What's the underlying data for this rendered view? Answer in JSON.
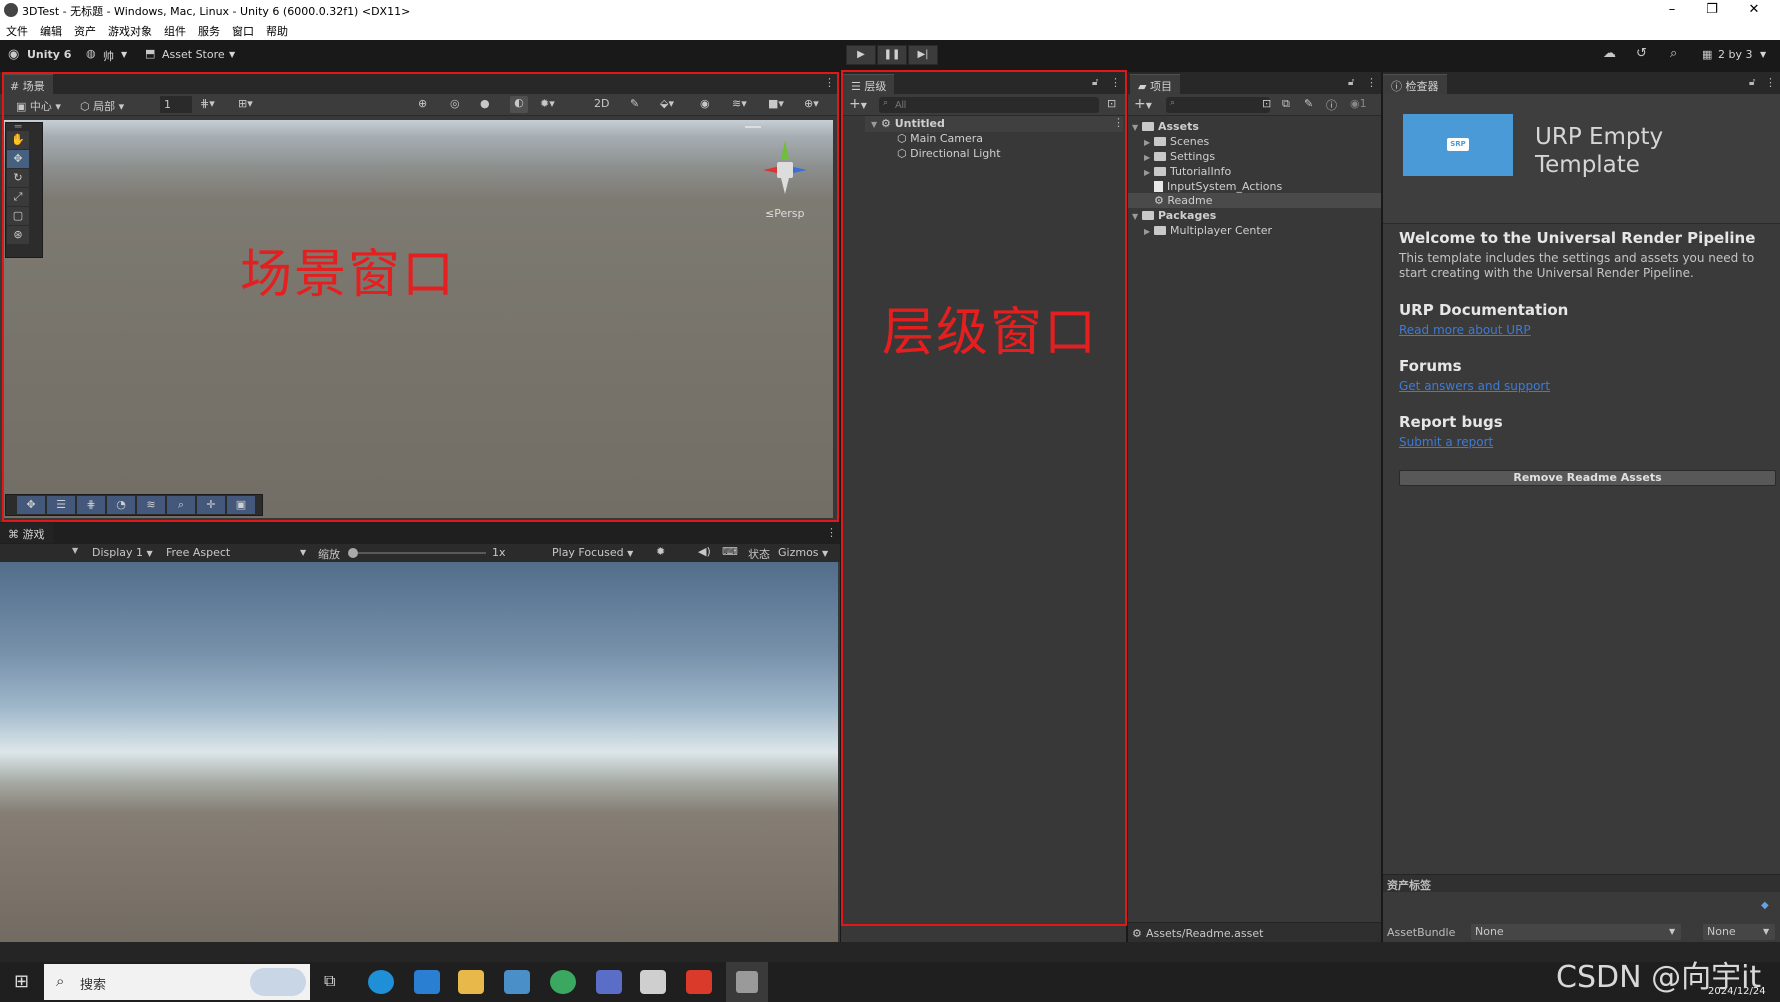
{
  "window": {
    "title": "3DTest - 无标题 - Windows, Mac, Linux - Unity 6 (6000.0.32f1) <DX11>",
    "minimize": "–",
    "maximize": "❐",
    "close": "✕"
  },
  "menu": [
    "文件",
    "编辑",
    "资产",
    "游戏对象",
    "组件",
    "服务",
    "窗口",
    "帮助"
  ],
  "toolbar": {
    "unity_label": "Unity 6",
    "account_label": "帅",
    "asset_store_label": "Asset Store",
    "play": "▶",
    "pause": "❚❚",
    "step": "▶|",
    "layout_label": "2 by 3"
  },
  "scene": {
    "tab_label": "场景",
    "pivot_label": "中心",
    "space_label": "局部",
    "snap_value": "1",
    "persp_label": "≤Persp",
    "overlay_text": "场景窗口"
  },
  "game": {
    "tab_label": "游戏",
    "display_label": "Display 1",
    "aspect_label": "Free Aspect",
    "scale_label": "缩放",
    "scale_value": "1x",
    "play_focused_label": "Play Focused",
    "stats_label": "状态",
    "gizmos_label": "Gizmos"
  },
  "hierarchy": {
    "tab_label": "层级",
    "search_placeholder": "All",
    "scene_name": "Untitled",
    "items": [
      "Main Camera",
      "Directional Light"
    ],
    "overlay_text": "层级窗口"
  },
  "project": {
    "tab_label": "项目",
    "assets_label": "Assets",
    "asset_children": [
      "Scenes",
      "Settings",
      "TutorialInfo",
      "InputSystem_Actions",
      "Readme"
    ],
    "packages_label": "Packages",
    "package_children": [
      "Multiplayer Center"
    ],
    "hidden_count": "1",
    "footer_path": "Assets/Readme.asset"
  },
  "inspector": {
    "tab_label": "检查器",
    "header_title_line1": "URP Empty",
    "header_title_line2": "Template",
    "logo_text": "SRP",
    "welcome_title": "Welcome to the Universal Render Pipeline",
    "welcome_line1": "This template includes the settings and assets you need to",
    "welcome_line2": "start creating with the Universal Render Pipeline.",
    "doc_title": "URP Documentation",
    "doc_link": "Read more about URP",
    "forums_title": "Forums",
    "forums_link": "Get answers and support",
    "bugs_title": "Report bugs",
    "bugs_link": "Submit a report",
    "remove_button": "Remove Readme Assets",
    "asset_labels_title": "资产标签",
    "assetbundle_label": "AssetBundle",
    "assetbundle_value": "None",
    "variant_value": "None"
  },
  "taskbar": {
    "search_label": "搜索",
    "date": "2024/12/24"
  },
  "watermark": "CSDN @向宇it",
  "colors": {
    "annotation_red": "#e01818",
    "link_blue": "#3d7bd5",
    "panel_bg": "#383838",
    "urp_logo_bg": "#4b9ad8"
  }
}
